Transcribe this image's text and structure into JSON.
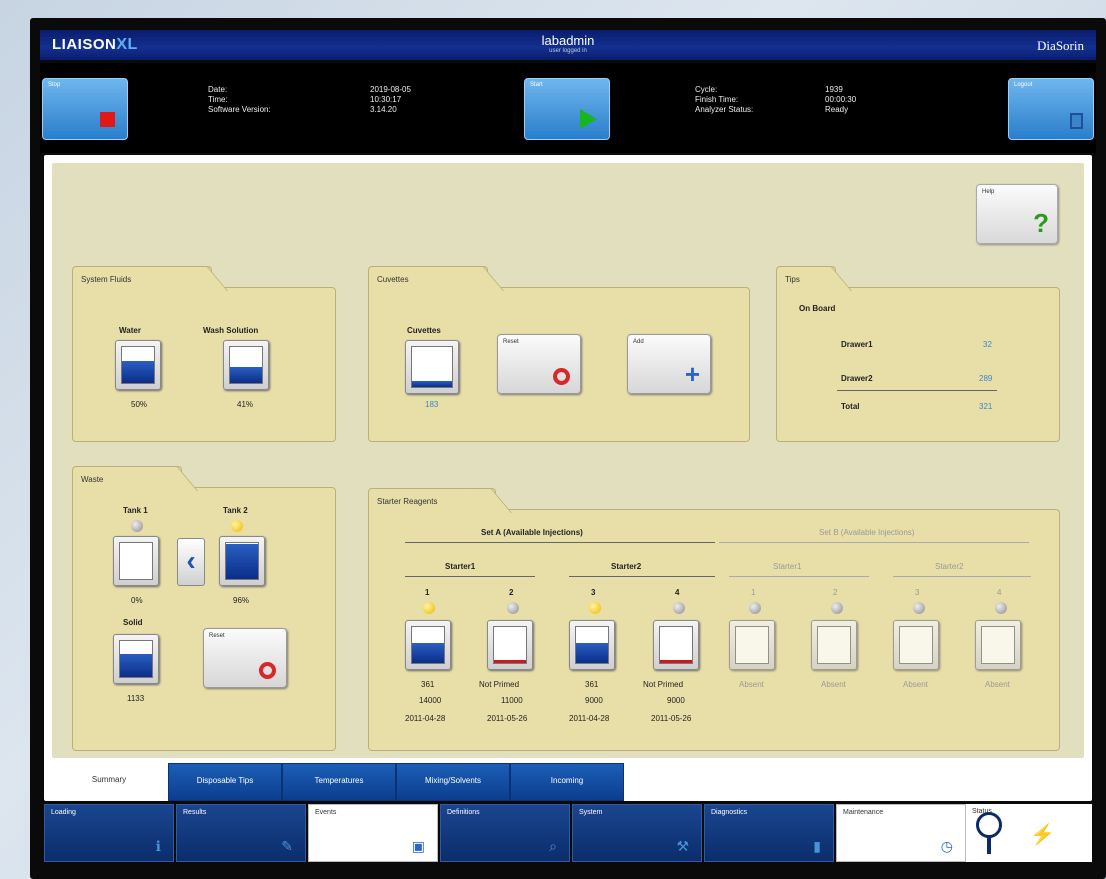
{
  "header": {
    "brand": "LIAISON",
    "brand_suffix": "XL",
    "center_title": "labadmin",
    "center_subtitle": "user logged in",
    "right_brand": "DiaSorin"
  },
  "status": {
    "stop_label": "Stop",
    "start_label": "Start",
    "logout_label": "Logout",
    "date_label": "Date:",
    "date_value": "2019-08-05",
    "time_label": "Time:",
    "time_value": "10:30:17",
    "sw_label": "Software Version:",
    "sw_value": "3.14.20",
    "cycle_label": "Cycle:",
    "cycle_value": "1939",
    "finish_label": "Finish Time:",
    "finish_value": "00:00:30",
    "analyzer_label": "Analyzer Status:",
    "analyzer_value": "Ready"
  },
  "help": {
    "label": "Help"
  },
  "system_fluids": {
    "title": "System Fluids",
    "water_label": "Water",
    "water_value": "50%",
    "water_level": 0.6,
    "wash_label": "Wash Solution",
    "wash_value": "41%",
    "wash_level": 0.45
  },
  "cuvettes": {
    "title": "Cuvettes",
    "cuvettes_label": "Cuvettes",
    "cuvettes_value": "183",
    "cuvettes_level": 0.15,
    "reset_label": "Reset",
    "add_label": "Add"
  },
  "tips": {
    "title": "Tips",
    "onboard_label": "On Board",
    "drawer1_label": "Drawer1",
    "drawer1_value": "32",
    "drawer2_label": "Drawer2",
    "drawer2_value": "289",
    "total_label": "Total",
    "total_value": "321"
  },
  "waste": {
    "title": "Waste",
    "tank1_label": "Tank 1",
    "tank1_value": "0%",
    "tank1_level": 0.0,
    "tank2_label": "Tank 2",
    "tank2_value": "96%",
    "tank2_level": 0.96,
    "solid_label": "Solid",
    "solid_value": "1133",
    "solid_level": 0.65,
    "reset_label": "Reset"
  },
  "starter": {
    "title": "Starter Reagents",
    "set_a": "Set A (Available Injections)",
    "set_b": "Set B (Available Injections)",
    "starter1": "Starter1",
    "starter2": "Starter2",
    "starter1b": "Starter1",
    "starter2b": "Starter2",
    "slots": [
      {
        "num": "1",
        "status": "361",
        "lot": "14000",
        "date": "2011-04-28"
      },
      {
        "num": "2",
        "status": "Not Primed",
        "lot": "11000",
        "date": "2011-05-26"
      },
      {
        "num": "3",
        "status": "361",
        "lot": "9000",
        "date": "2011-04-28"
      },
      {
        "num": "4",
        "status": "Not Primed",
        "lot": "9000",
        "date": "2011-05-26"
      },
      {
        "num": "1",
        "status": "Absent"
      },
      {
        "num": "2",
        "status": "Absent"
      },
      {
        "num": "3",
        "status": "Absent"
      },
      {
        "num": "4",
        "status": "Absent"
      }
    ]
  },
  "subtabs": [
    "Summary",
    "Disposable Tips",
    "Temperatures",
    "Mixing/Solvents",
    "Incoming"
  ],
  "nav": [
    "Loading",
    "Results",
    "Events",
    "Definitions",
    "System",
    "Diagnostics",
    "Maintenance",
    "Status"
  ]
}
